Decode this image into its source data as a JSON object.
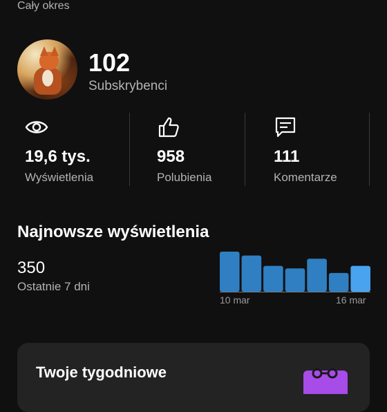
{
  "header": {
    "period_label": "Cały okres"
  },
  "channel": {
    "subscribers": "102",
    "subscribers_label": "Subskrybenci"
  },
  "stats": [
    {
      "icon": "eye-icon",
      "value": "19,6 tys.",
      "label": "Wyświetlenia"
    },
    {
      "icon": "thumbs-up-icon",
      "value": "958",
      "label": "Polubienia"
    },
    {
      "icon": "comment-icon",
      "value": "111",
      "label": "Komentarze"
    }
  ],
  "recent": {
    "title": "Najnowsze wyświetlenia",
    "value": "350",
    "label": "Ostatnie 7 dni"
  },
  "chart_data": {
    "type": "bar",
    "categories": [
      "10 mar",
      "11 mar",
      "12 mar",
      "13 mar",
      "14 mar",
      "15 mar",
      "16 mar"
    ],
    "values": [
      62,
      56,
      40,
      36,
      51,
      29,
      40
    ],
    "x_tick_labels": [
      "10 mar",
      "16 mar"
    ],
    "colors": {
      "bar": "#2f7fc2",
      "highlight": "#49a3ee",
      "baseline": "#7a7a7a"
    }
  },
  "card": {
    "title": "Twoje tygodniowe",
    "icon": "calendar-icon",
    "accent": "#a74be9"
  }
}
